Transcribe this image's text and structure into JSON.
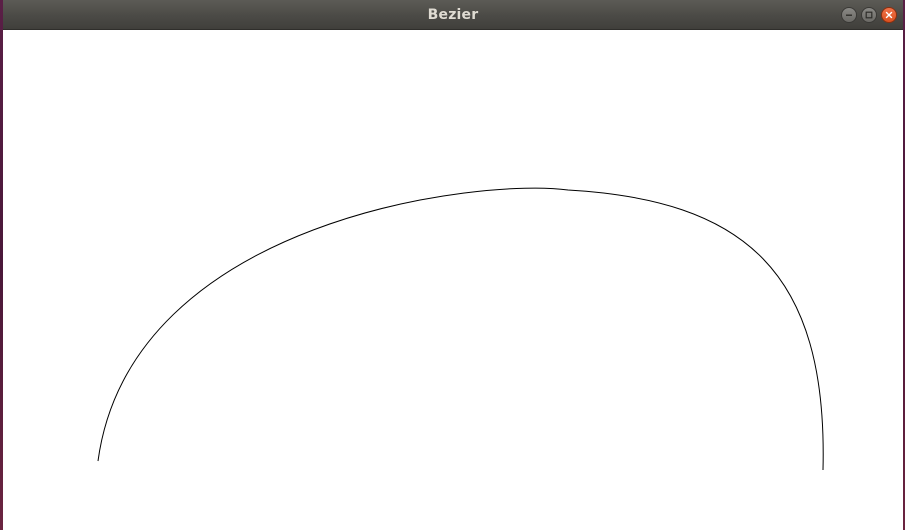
{
  "window": {
    "title": "Bezier",
    "controls": {
      "minimize_icon": "minimize-icon",
      "maximize_icon": "maximize-icon",
      "close_icon": "close-icon"
    },
    "colors": {
      "titlebar": "#4b4a46",
      "title_text": "#dfdbd2",
      "close_button": "#e05a2b",
      "canvas_background": "#ffffff",
      "curve_stroke": "#000000"
    }
  }
}
